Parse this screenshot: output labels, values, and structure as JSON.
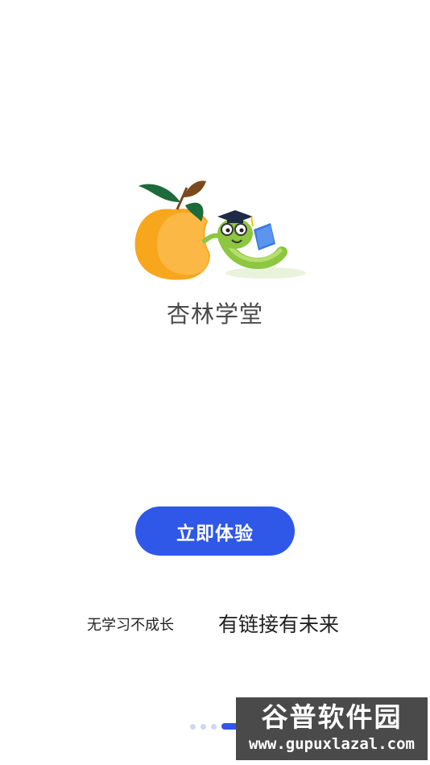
{
  "app": {
    "brand_name": "杏林学堂"
  },
  "cta": {
    "label": "立即体验"
  },
  "slogan": {
    "left": "无学习不成长",
    "right": "有链接有未来"
  },
  "pager": {
    "total": 4,
    "active_index": 3
  },
  "watermark": {
    "title": "谷普软件园",
    "url": "www.gupuxlazal.com"
  },
  "colors": {
    "accent": "#2f57e8",
    "apricot": "#f7a41d",
    "leaf": "#1d6b3a",
    "worm": "#8dc63f"
  }
}
